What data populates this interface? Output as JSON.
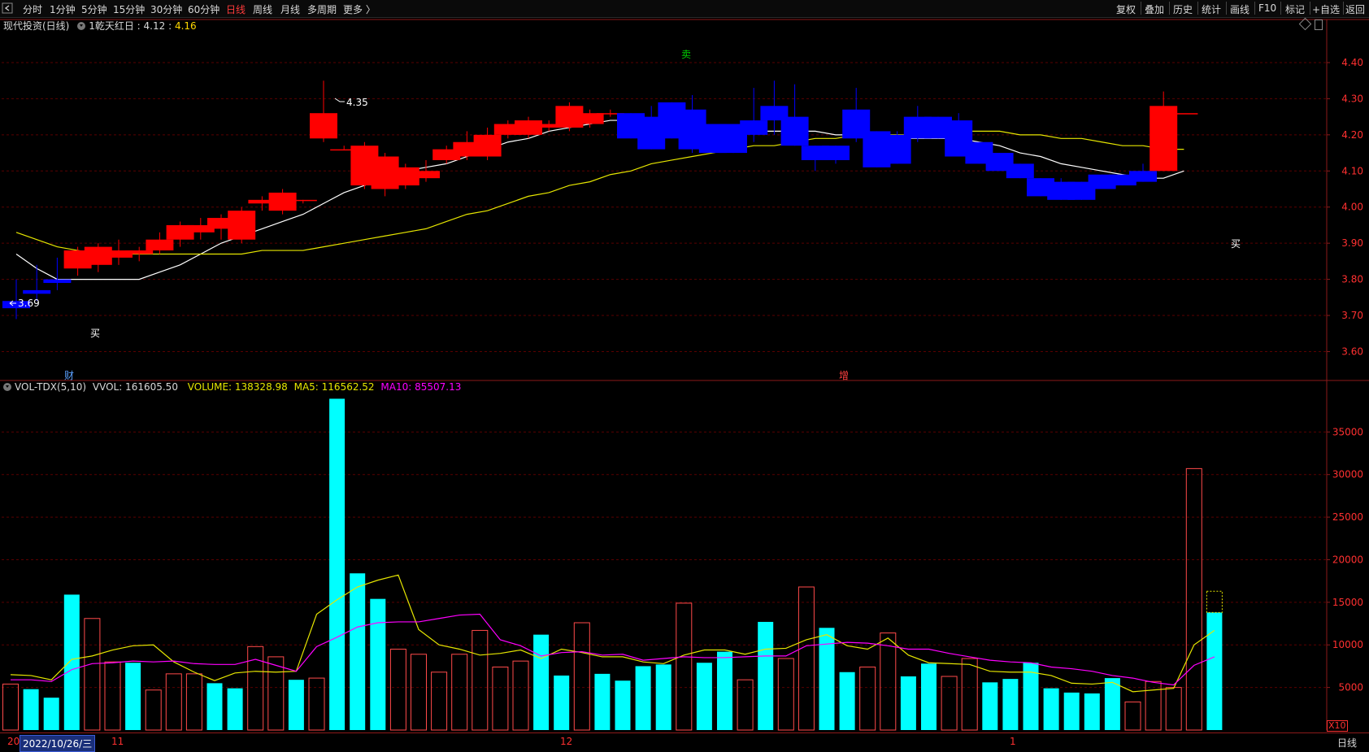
{
  "toolbar": {
    "back_icon": "back-arrow-icon",
    "periods": [
      "分时",
      "1分钟",
      "5分钟",
      "15分钟",
      "30分钟",
      "60分钟",
      "日线",
      "周线",
      "月线",
      "多周期",
      "更多 〉"
    ],
    "active_period": "日线",
    "right_items": [
      "复权",
      "叠加",
      "历史",
      "统计",
      "画线",
      "F10",
      "标记",
      "+自选",
      "返回"
    ]
  },
  "main_panel": {
    "title": "现代投资(日线)",
    "indicator_name": "1乾天红日",
    "indicator_value_1": "4.12",
    "indicator_value_2": "4.16",
    "high_label": "4.35",
    "low_label": "3.69",
    "signals": [
      {
        "text": "买",
        "color": "#ffffff"
      },
      {
        "text": "卖",
        "color": "#00d000"
      },
      {
        "text": "买",
        "color": "#ffffff"
      },
      {
        "text": "财",
        "color": "#5aa0ff"
      },
      {
        "text": "增",
        "color": "#ff4040"
      }
    ]
  },
  "volume_panel": {
    "indicator": "VOL-TDX(5,10)",
    "vvol_label": "VVOL: 161605.50",
    "volume_label": "VOLUME: 138328.98",
    "ma5_label": "MA5: 116562.52",
    "ma10_label": "MA10: 85507.13",
    "unit_label": "X10"
  },
  "footer": {
    "date_tooltip": "2022/10/26/三",
    "partial_label": "20",
    "month_labels": [
      "11",
      "12",
      "1"
    ],
    "period_label": "日线"
  },
  "colors": {
    "up": "#ff0000",
    "down": "#0000ff",
    "vol_down": "#00ffff",
    "vol_up_outline": "#ff4a4a",
    "ma_white": "#ffffff",
    "ma_yellow": "#e6e600",
    "ma10": "#ff00ff",
    "grid": "#5a0000",
    "axis_text": "#ff3030"
  },
  "chart_data": [
    {
      "type": "candlestick",
      "title": "现代投资(日线)",
      "y_ticks": [
        3.6,
        3.7,
        3.8,
        3.9,
        4.0,
        4.1,
        4.2,
        4.3,
        4.4
      ],
      "ylim": [
        3.52,
        4.49
      ],
      "candles": [
        {
          "o": 3.74,
          "h": 3.8,
          "l": 3.69,
          "c": 3.72
        },
        {
          "o": 3.77,
          "h": 3.84,
          "l": 3.74,
          "c": 3.76
        },
        {
          "o": 3.8,
          "h": 3.86,
          "l": 3.77,
          "c": 3.79
        },
        {
          "o": 3.83,
          "h": 3.89,
          "l": 3.81,
          "c": 3.88
        },
        {
          "o": 3.84,
          "h": 3.9,
          "l": 3.82,
          "c": 3.89
        },
        {
          "o": 3.86,
          "h": 3.91,
          "l": 3.84,
          "c": 3.88
        },
        {
          "o": 3.87,
          "h": 3.89,
          "l": 3.85,
          "c": 3.88
        },
        {
          "o": 3.88,
          "h": 3.93,
          "l": 3.87,
          "c": 3.91
        },
        {
          "o": 3.91,
          "h": 3.96,
          "l": 3.89,
          "c": 3.95
        },
        {
          "o": 3.93,
          "h": 3.97,
          "l": 3.91,
          "c": 3.95
        },
        {
          "o": 3.94,
          "h": 3.98,
          "l": 3.91,
          "c": 3.97
        },
        {
          "o": 3.91,
          "h": 4.0,
          "l": 3.9,
          "c": 3.99
        },
        {
          "o": 4.01,
          "h": 4.03,
          "l": 3.99,
          "c": 4.02
        },
        {
          "o": 3.99,
          "h": 4.05,
          "l": 3.98,
          "c": 4.04
        },
        {
          "o": 4.02,
          "h": 4.02,
          "l": 4.01,
          "c": 4.02
        },
        {
          "o": 4.19,
          "h": 4.35,
          "l": 4.18,
          "c": 4.26
        },
        {
          "o": 4.16,
          "h": 4.17,
          "l": 4.16,
          "c": 4.16
        },
        {
          "o": 4.06,
          "h": 4.18,
          "l": 4.05,
          "c": 4.17
        },
        {
          "o": 4.05,
          "h": 4.15,
          "l": 4.03,
          "c": 4.14
        },
        {
          "o": 4.06,
          "h": 4.12,
          "l": 4.05,
          "c": 4.11
        },
        {
          "o": 4.08,
          "h": 4.13,
          "l": 4.07,
          "c": 4.1
        },
        {
          "o": 4.13,
          "h": 4.17,
          "l": 4.12,
          "c": 4.16
        },
        {
          "o": 4.14,
          "h": 4.21,
          "l": 4.13,
          "c": 4.18
        },
        {
          "o": 4.14,
          "h": 4.22,
          "l": 4.13,
          "c": 4.2
        },
        {
          "o": 4.2,
          "h": 4.24,
          "l": 4.19,
          "c": 4.23
        },
        {
          "o": 4.2,
          "h": 4.25,
          "l": 4.19,
          "c": 4.24
        },
        {
          "o": 4.22,
          "h": 4.24,
          "l": 4.21,
          "c": 4.23
        },
        {
          "o": 4.22,
          "h": 4.29,
          "l": 4.21,
          "c": 4.28
        },
        {
          "o": 4.23,
          "h": 4.27,
          "l": 4.22,
          "c": 4.26
        },
        {
          "o": 4.26,
          "h": 4.27,
          "l": 4.25,
          "c": 4.26
        },
        {
          "o": 4.26,
          "h": 4.26,
          "l": 4.19,
          "c": 4.19
        },
        {
          "o": 4.25,
          "h": 4.28,
          "l": 4.16,
          "c": 4.16
        },
        {
          "o": 4.29,
          "h": 4.29,
          "l": 4.19,
          "c": 4.19
        },
        {
          "o": 4.27,
          "h": 4.31,
          "l": 4.15,
          "c": 4.16
        },
        {
          "o": 4.23,
          "h": 4.23,
          "l": 4.15,
          "c": 4.15
        },
        {
          "o": 4.23,
          "h": 4.23,
          "l": 4.15,
          "c": 4.15
        },
        {
          "o": 4.24,
          "h": 4.33,
          "l": 4.18,
          "c": 4.2
        },
        {
          "o": 4.28,
          "h": 4.35,
          "l": 4.2,
          "c": 4.24
        },
        {
          "o": 4.25,
          "h": 4.34,
          "l": 4.17,
          "c": 4.17
        },
        {
          "o": 4.17,
          "h": 4.17,
          "l": 4.1,
          "c": 4.13
        },
        {
          "o": 4.17,
          "h": 4.17,
          "l": 4.12,
          "c": 4.13
        },
        {
          "o": 4.27,
          "h": 4.33,
          "l": 4.18,
          "c": 4.19
        },
        {
          "o": 4.21,
          "h": 4.21,
          "l": 4.11,
          "c": 4.11
        },
        {
          "o": 4.2,
          "h": 4.21,
          "l": 4.12,
          "c": 4.12
        },
        {
          "o": 4.25,
          "h": 4.28,
          "l": 4.18,
          "c": 4.19
        },
        {
          "o": 4.25,
          "h": 4.25,
          "l": 4.19,
          "c": 4.19
        },
        {
          "o": 4.24,
          "h": 4.26,
          "l": 4.14,
          "c": 4.14
        },
        {
          "o": 4.18,
          "h": 4.18,
          "l": 4.12,
          "c": 4.12
        },
        {
          "o": 4.15,
          "h": 4.15,
          "l": 4.1,
          "c": 4.1
        },
        {
          "o": 4.12,
          "h": 4.12,
          "l": 4.08,
          "c": 4.08
        },
        {
          "o": 4.08,
          "h": 4.08,
          "l": 4.03,
          "c": 4.03
        },
        {
          "o": 4.07,
          "h": 4.08,
          "l": 4.02,
          "c": 4.02
        },
        {
          "o": 4.07,
          "h": 4.07,
          "l": 4.02,
          "c": 4.02
        },
        {
          "o": 4.09,
          "h": 4.09,
          "l": 4.05,
          "c": 4.05
        },
        {
          "o": 4.09,
          "h": 4.09,
          "l": 4.06,
          "c": 4.06
        },
        {
          "o": 4.1,
          "h": 4.12,
          "l": 4.07,
          "c": 4.07
        },
        {
          "o": 4.1,
          "h": 4.32,
          "l": 4.1,
          "c": 4.28
        },
        {
          "o": 4.26,
          "h": 4.26,
          "l": 4.26,
          "c": 4.26
        }
      ],
      "ma_white": [
        3.87,
        3.83,
        3.8,
        3.8,
        3.8,
        3.8,
        3.8,
        3.82,
        3.84,
        3.87,
        3.9,
        3.92,
        3.94,
        3.96,
        3.98,
        4.01,
        4.04,
        4.06,
        4.08,
        4.1,
        4.11,
        4.12,
        4.14,
        4.16,
        4.18,
        4.19,
        4.21,
        4.22,
        4.23,
        4.24,
        4.24,
        4.24,
        4.24,
        4.23,
        4.22,
        4.21,
        4.21,
        4.21,
        4.21,
        4.21,
        4.2,
        4.2,
        4.2,
        4.19,
        4.19,
        4.19,
        4.19,
        4.18,
        4.17,
        4.15,
        4.14,
        4.12,
        4.11,
        4.1,
        4.09,
        4.08,
        4.08,
        4.1
      ],
      "ma_yellow": [
        3.93,
        3.91,
        3.89,
        3.88,
        3.87,
        3.87,
        3.87,
        3.87,
        3.87,
        3.87,
        3.87,
        3.87,
        3.88,
        3.88,
        3.88,
        3.89,
        3.9,
        3.91,
        3.92,
        3.93,
        3.94,
        3.96,
        3.98,
        3.99,
        4.01,
        4.03,
        4.04,
        4.06,
        4.07,
        4.09,
        4.1,
        4.12,
        4.13,
        4.14,
        4.15,
        4.16,
        4.17,
        4.17,
        4.18,
        4.19,
        4.19,
        4.2,
        4.2,
        4.2,
        4.2,
        4.21,
        4.21,
        4.21,
        4.21,
        4.2,
        4.2,
        4.19,
        4.19,
        4.18,
        4.17,
        4.17,
        4.16,
        4.16
      ]
    },
    {
      "type": "bar",
      "title": "VOL-TDX(5,10)",
      "y_ticks": [
        5000,
        10000,
        15000,
        20000,
        25000,
        30000,
        35000
      ],
      "ylim": [
        0,
        39900
      ],
      "unit": "X10",
      "volumes": [
        5400,
        4800,
        3800,
        15900,
        13100,
        8000,
        7900,
        4700,
        6600,
        6600,
        5500,
        4900,
        9800,
        8600,
        5900,
        6100,
        38900,
        18400,
        15400,
        9500,
        8900,
        6800,
        8900,
        11700,
        7400,
        8100,
        11200,
        6400,
        12600,
        6600,
        5800,
        7500,
        7700,
        14900,
        7900,
        9200,
        5900,
        12700,
        8400,
        16800,
        12000,
        6800,
        7400,
        11400,
        6300,
        7800,
        6300,
        8400,
        5600,
        6000,
        7900,
        4900,
        4400,
        4300,
        6100,
        3300,
        5700,
        5000,
        30700,
        13800
      ],
      "vol_dir": [
        "up",
        "down",
        "down",
        "down",
        "up",
        "up",
        "down",
        "up",
        "up",
        "up",
        "down",
        "down",
        "up",
        "up",
        "down",
        "up",
        "down",
        "down",
        "down",
        "up",
        "up",
        "up",
        "up",
        "up",
        "up",
        "up",
        "down",
        "down",
        "up",
        "down",
        "down",
        "down",
        "down",
        "up",
        "down",
        "down",
        "up",
        "down",
        "up",
        "up",
        "down",
        "down",
        "up",
        "up",
        "down",
        "down",
        "up",
        "up",
        "down",
        "down",
        "down",
        "down",
        "down",
        "down",
        "down",
        "up",
        "up",
        "up",
        "up",
        "down"
      ],
      "ma5": [
        6500,
        6400,
        5900,
        8300,
        8700,
        9400,
        9900,
        10000,
        8000,
        6800,
        5800,
        6700,
        6900,
        6800,
        6900,
        13600,
        15300,
        16800,
        17600,
        18200,
        11800,
        10000,
        9500,
        8800,
        9000,
        9400,
        8400,
        9500,
        9100,
        8600,
        8600,
        8000,
        7800,
        8800,
        9400,
        9400,
        8900,
        9500,
        9600,
        10600,
        11200,
        9900,
        9500,
        10800,
        8800,
        7900,
        7800,
        7700,
        6900,
        6800,
        6800,
        6400,
        5500,
        5400,
        5600,
        4500,
        4700,
        4900,
        10000,
        11700
      ],
      "ma10": [
        5900,
        5900,
        5700,
        7100,
        7800,
        7900,
        8100,
        8000,
        8100,
        7800,
        7700,
        7700,
        8300,
        7600,
        6900,
        9800,
        10900,
        12100,
        12600,
        12700,
        12700,
        13100,
        13500,
        13600,
        10600,
        9900,
        8700,
        9100,
        9200,
        8800,
        8900,
        8200,
        8400,
        8600,
        8500,
        8500,
        8600,
        8700,
        8700,
        9900,
        10100,
        10300,
        10200,
        9900,
        9500,
        9500,
        9000,
        8600,
        8200,
        8000,
        7900,
        7400,
        7200,
        6900,
        6400,
        6100,
        5600,
        5300,
        7600,
        8600
      ]
    }
  ]
}
